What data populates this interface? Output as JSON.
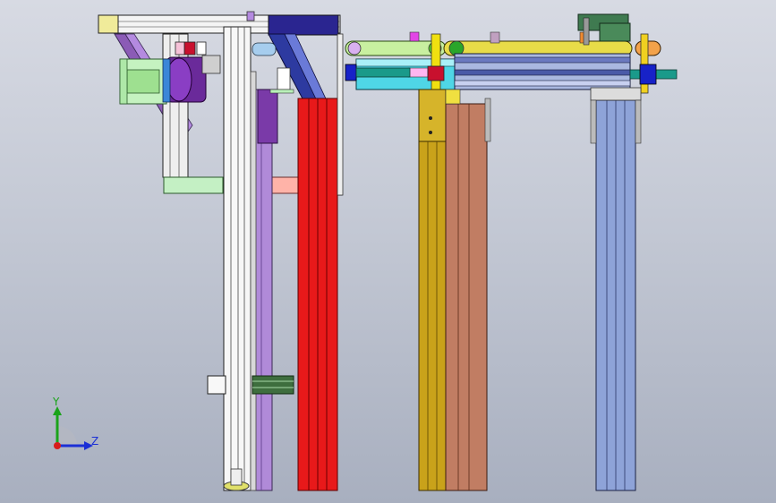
{
  "viewport": {
    "background_top": "#d7dae3",
    "background_bottom": "#a8afbf"
  },
  "triad": {
    "y_label": "Y",
    "z_label": "Z",
    "y_color": "#1aa31a",
    "z_color": "#1b2fd6",
    "x_color": "#d81c1c"
  },
  "colors": {
    "rail_red": "#e8191a",
    "rail_gold": "#c9a21a",
    "rail_copper": "#c17d63",
    "rail_blue": "#8ea3d8",
    "rail_purple": "#9b74c9",
    "accent_lime": "#9ee63c",
    "accent_pink": "#ffb3a8",
    "accent_mint": "#b9f0b9",
    "accent_cyan": "#47d7e6",
    "accent_navy": "#22237a"
  }
}
